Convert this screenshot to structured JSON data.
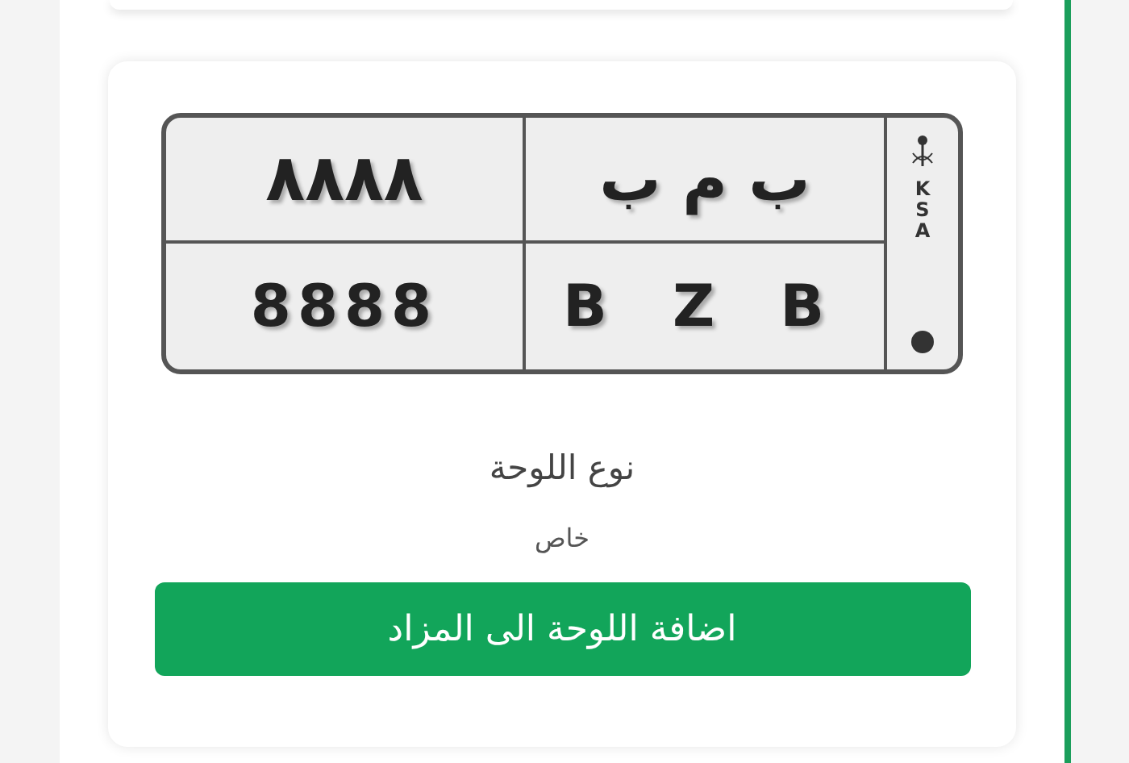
{
  "plate": {
    "arabic_numbers": "٨٨٨٨",
    "arabic_letters": "ب م ب",
    "latin_numbers": "8888",
    "latin_letters": "B Z B",
    "country": "KSA"
  },
  "plate_type": {
    "label": "نوع اللوحة",
    "value": "خاص"
  },
  "add_button": "اضافة اللوحة الى المزاد"
}
